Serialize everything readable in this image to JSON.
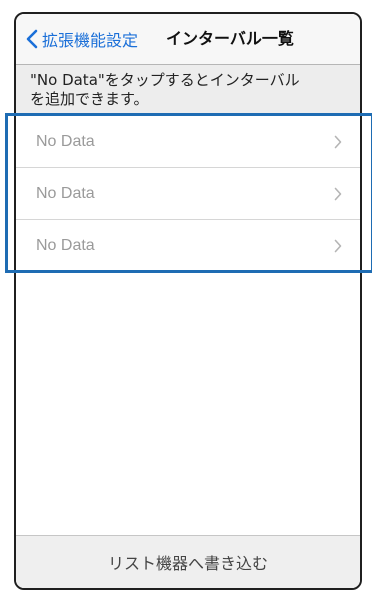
{
  "navbar": {
    "back_label": "拡張機能設定",
    "title": "インターバル一覧"
  },
  "info": {
    "text_line1": "\"No Data\"をタップするとインターバル",
    "text_line2": "を追加できます。"
  },
  "rows": [
    {
      "label": "No Data"
    },
    {
      "label": "No Data"
    },
    {
      "label": "No Data"
    }
  ],
  "bottom": {
    "button_label": "リスト機器へ書き込む"
  },
  "colors": {
    "accent": "#1a6fd8",
    "highlight": "#1e6cb3"
  }
}
